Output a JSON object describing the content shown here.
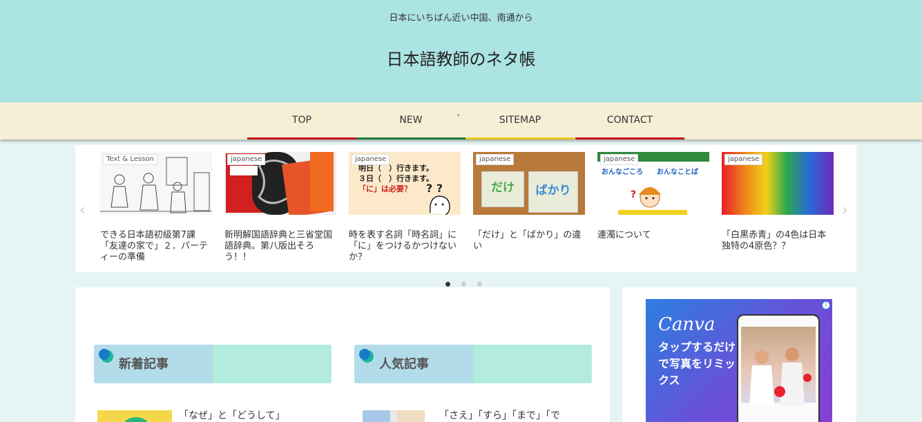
{
  "header": {
    "tagline": "日本にいちばん近い中国、南通から",
    "title": "日本語教師のネタ帳"
  },
  "nav": {
    "items": [
      {
        "label": "TOP",
        "color": "#c8161d"
      },
      {
        "label": "NEW",
        "color": "#1e7a3a"
      },
      {
        "label": "SITEMAP",
        "color": "#e8c81a"
      },
      {
        "label": "CONTACT",
        "color": "#c8161d"
      }
    ],
    "chevron": "˅"
  },
  "slider": {
    "prev_icon": "‹",
    "next_icon": "›",
    "cards": [
      {
        "category": "Text & Lesson",
        "title": "できる日本語初級第7課「友達の家で」２．パーティーの準備"
      },
      {
        "category": "japanese",
        "title": "新明解国語辞典と三省堂国語辞典。第八版出そろう！！"
      },
      {
        "category": "japanese",
        "title": "時を表す名詞「時名詞」に「に」をつけるかつけないか？",
        "img_line1": "明日（　）行きます。",
        "img_line2": "３日（　）行きます。",
        "img_line3": "「に」は必要？"
      },
      {
        "category": "japanese",
        "title": "「だけ」と「ばかり」の違い",
        "img_word1": "だけ",
        "img_word2": "ばかり"
      },
      {
        "category": "japanese",
        "title": "連濁について",
        "img_word1": "おんなごころ",
        "img_word2": "おんなことば"
      },
      {
        "category": "japanese",
        "title": "「白黒赤青」の4色は日本独特の4原色？？"
      }
    ],
    "dots": 3,
    "active_dot": 0
  },
  "sections": [
    {
      "title": "新着記事",
      "first_post": "「なぜ」と「どうして」"
    },
    {
      "title": "人気記事",
      "first_post": "「さえ」「すら」「まで」「で"
    }
  ],
  "ad": {
    "brand": "Canva",
    "copy": "タップするだけで写真をリミックス",
    "info_icon": "i"
  }
}
